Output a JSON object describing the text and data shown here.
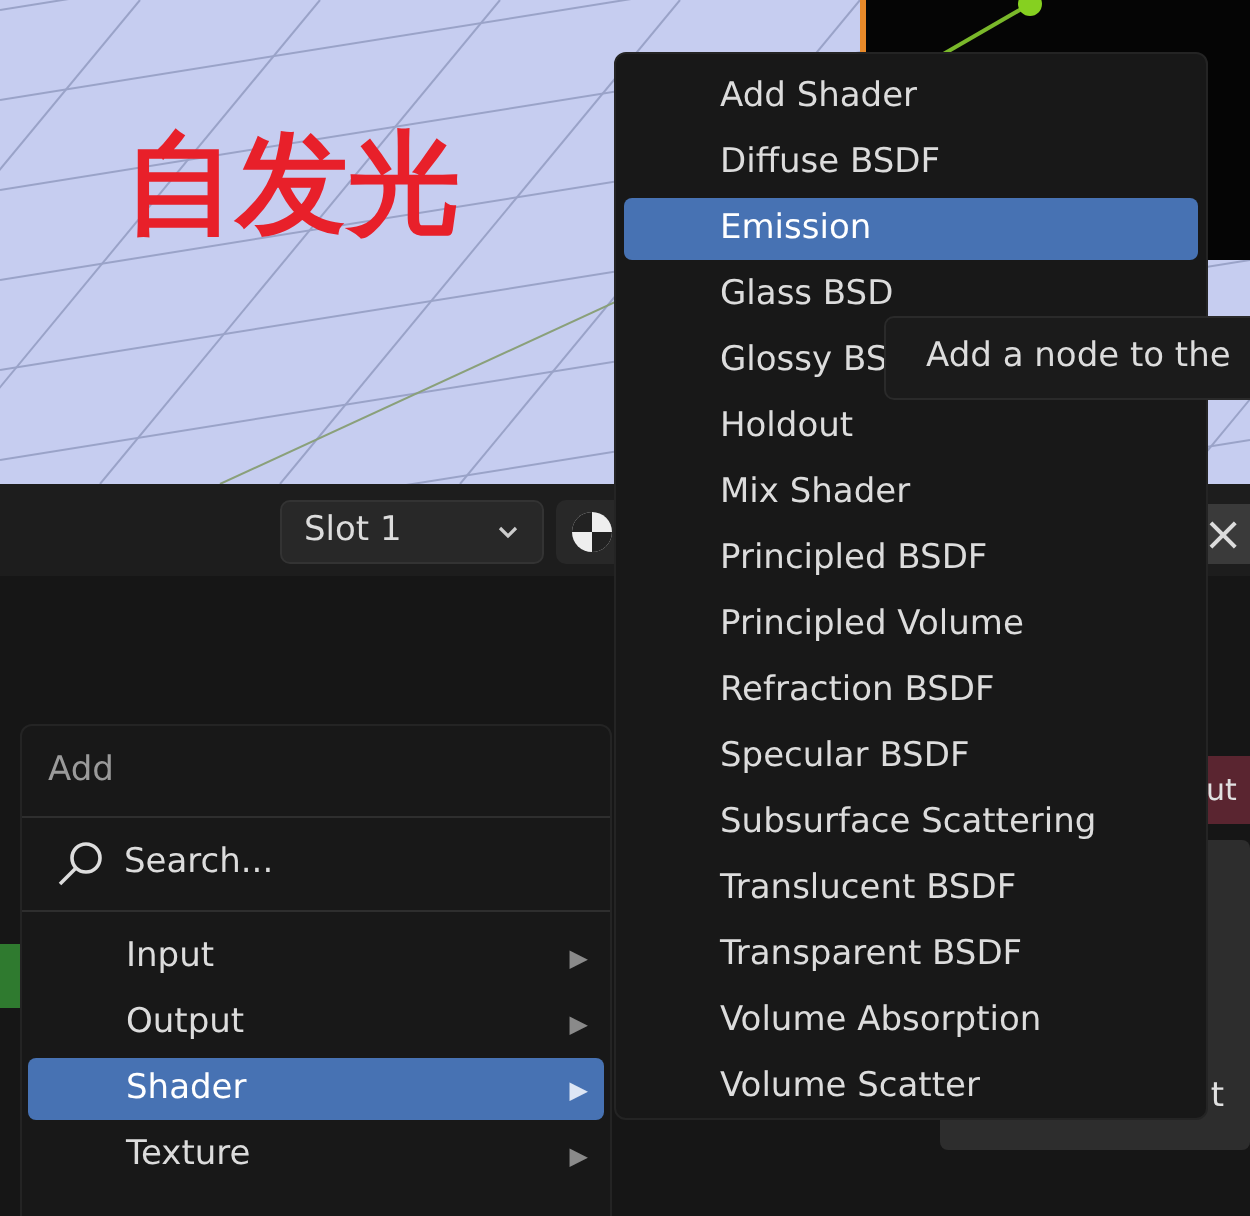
{
  "viewport": {
    "annotation": "自发光"
  },
  "header": {
    "slot": "Slot 1",
    "close": "×"
  },
  "nodes": [
    {
      "kind": "green"
    },
    {
      "kind": "red",
      "label": "ut"
    },
    {
      "kind": "grey",
      "label": "t"
    }
  ],
  "add_menu": {
    "title": "Add",
    "search": "Search...",
    "arrow": "▶",
    "items": [
      {
        "label": "Input",
        "selected": false
      },
      {
        "label": "Output",
        "selected": false
      },
      {
        "label": "Shader",
        "selected": true
      },
      {
        "label": "Texture",
        "selected": false
      }
    ]
  },
  "shader_menu": {
    "items": [
      {
        "label": "Add Shader",
        "selected": false
      },
      {
        "label": "Diffuse BSDF",
        "selected": false
      },
      {
        "label": "Emission",
        "selected": true
      },
      {
        "label": "Glass BSD",
        "selected": false
      },
      {
        "label": "Glossy BS",
        "selected": false
      },
      {
        "label": "Holdout",
        "selected": false
      },
      {
        "label": "Mix Shader",
        "selected": false
      },
      {
        "label": "Principled BSDF",
        "selected": false
      },
      {
        "label": "Principled Volume",
        "selected": false
      },
      {
        "label": "Refraction BSDF",
        "selected": false
      },
      {
        "label": "Specular BSDF",
        "selected": false
      },
      {
        "label": "Subsurface Scattering",
        "selected": false
      },
      {
        "label": "Translucent BSDF",
        "selected": false
      },
      {
        "label": "Transparent BSDF",
        "selected": false
      },
      {
        "label": "Volume Absorption",
        "selected": false
      },
      {
        "label": "Volume Scatter",
        "selected": false
      }
    ]
  },
  "tooltip": "Add a node to the"
}
